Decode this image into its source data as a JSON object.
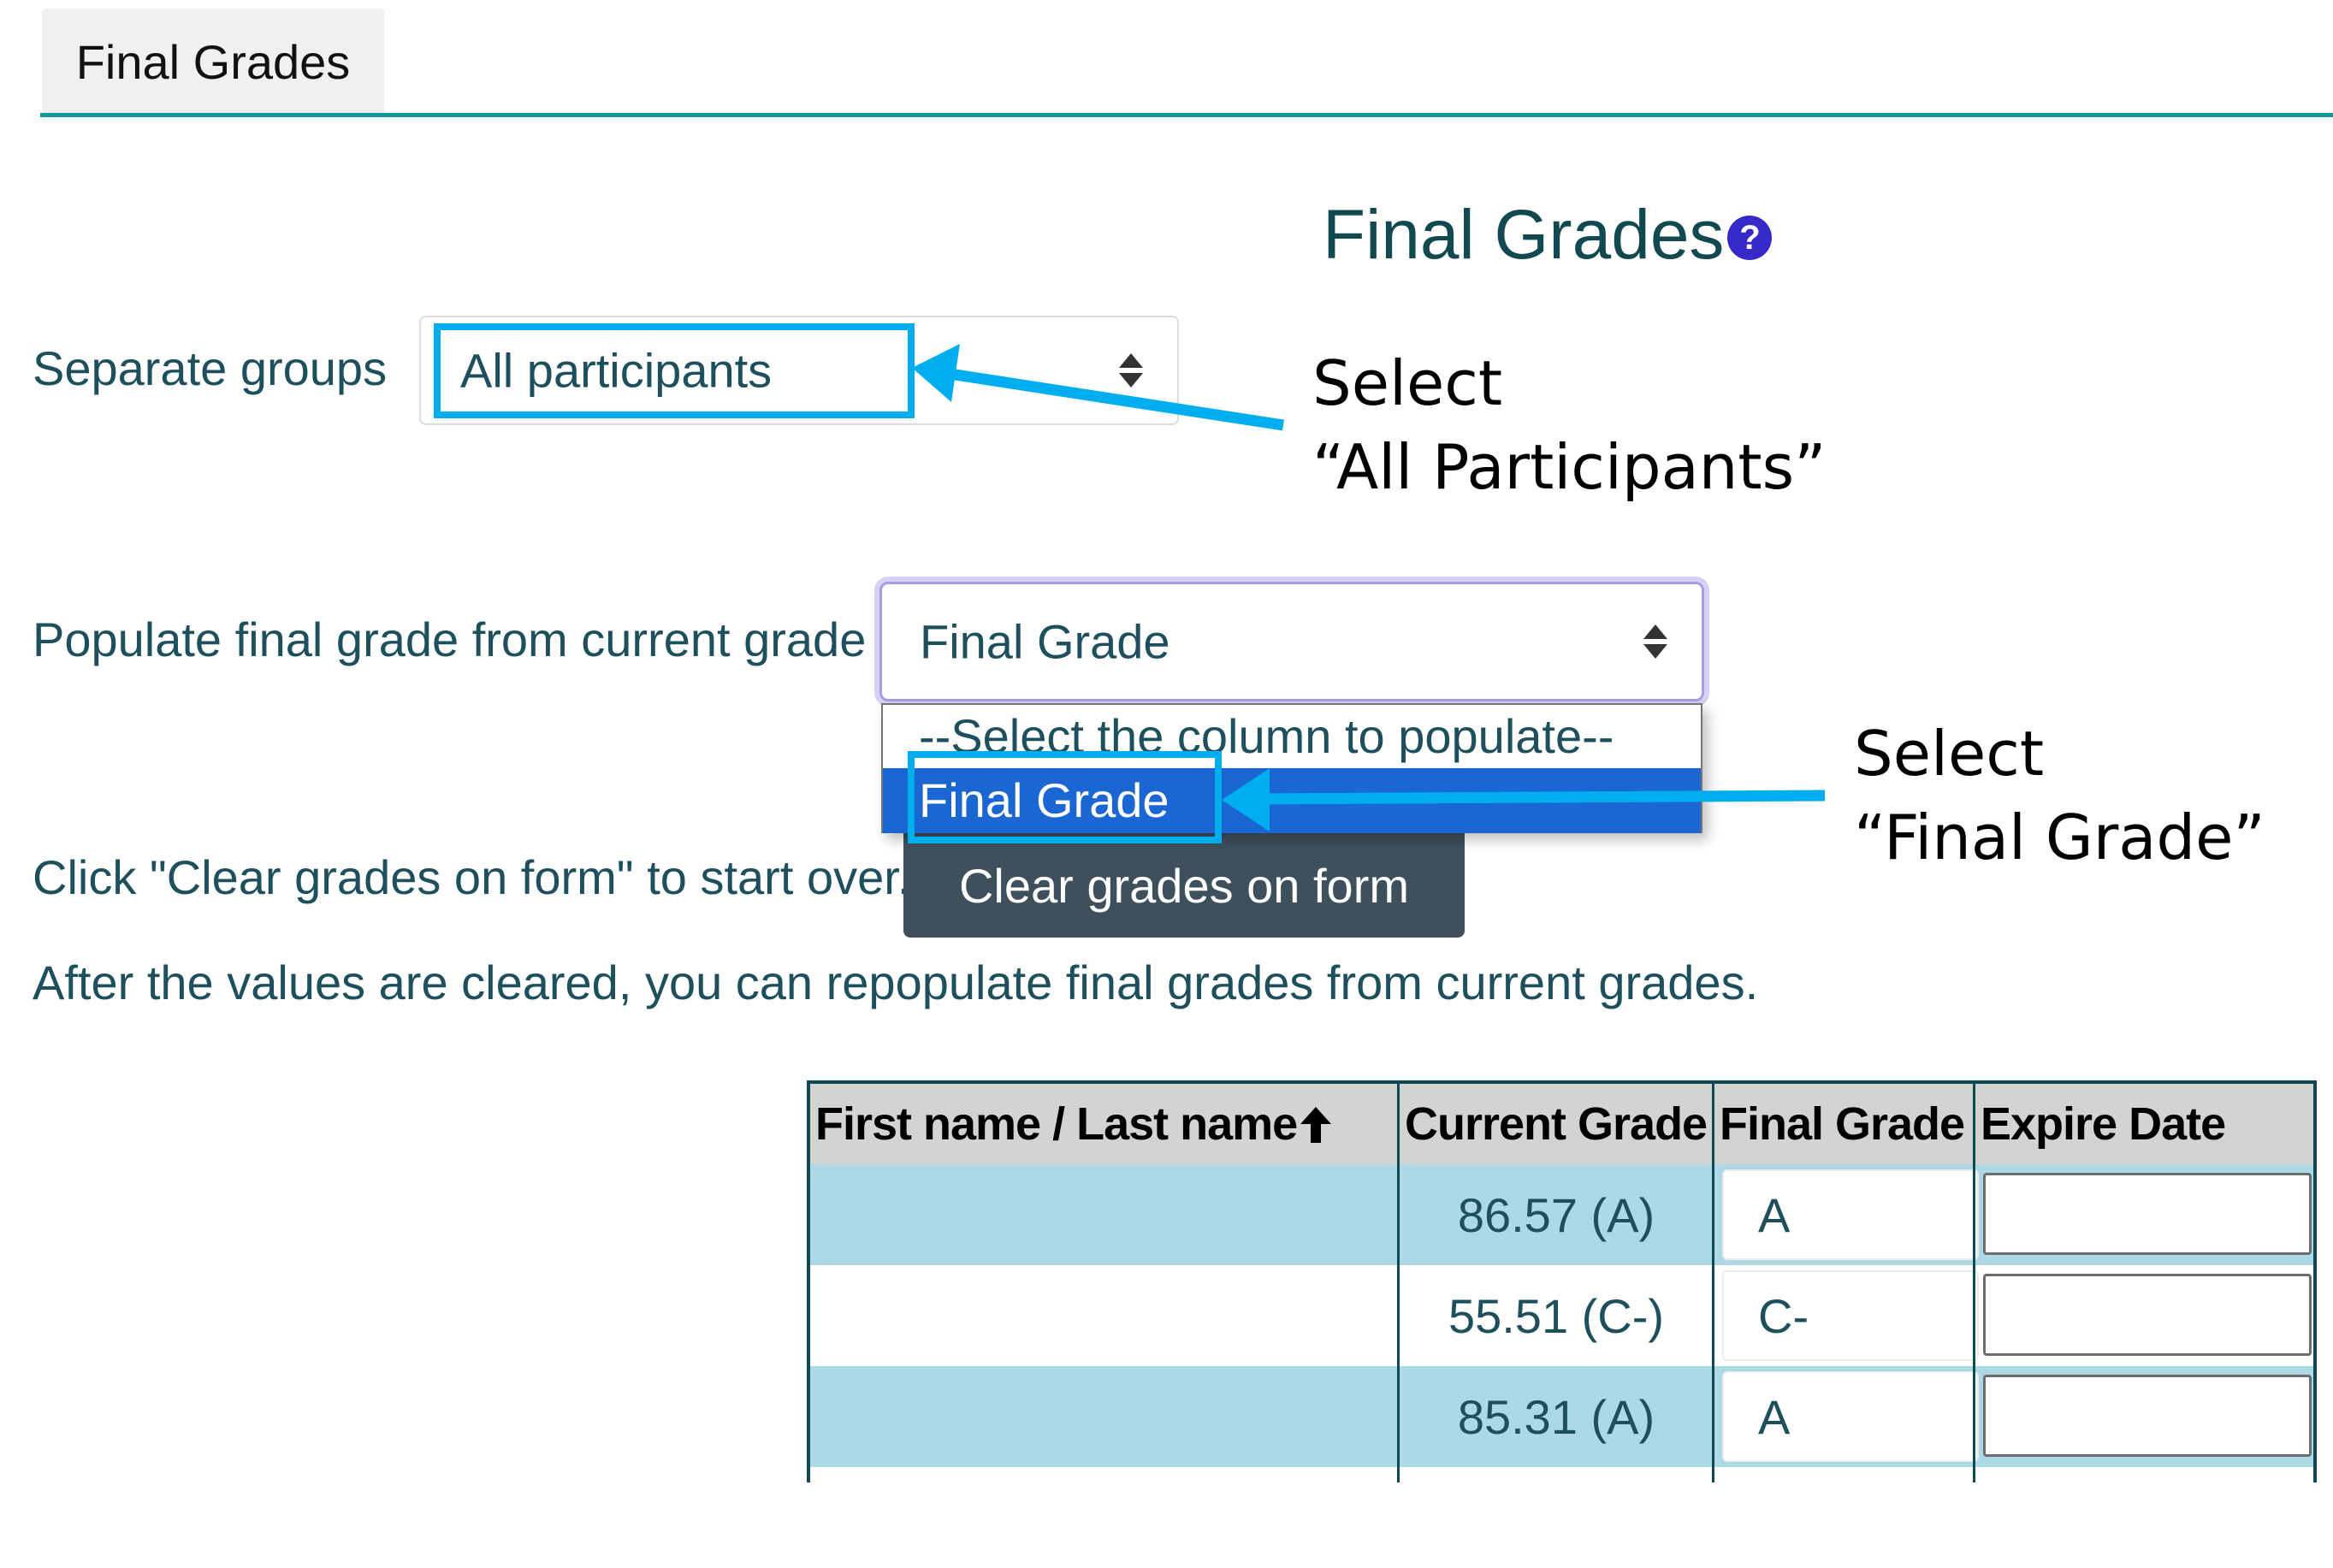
{
  "tabs": [
    {
      "label": "Final Grades",
      "active": true
    }
  ],
  "header": {
    "title": "Final Grades",
    "help_icon": "question-circle-icon"
  },
  "colors": {
    "accent": "#11969b",
    "highlight": "#00aeef",
    "selected_option": "#1a66d2",
    "button": "#3f505d",
    "row_alt": "#add8e6",
    "help": "#3728c9"
  },
  "group_filter": {
    "label": "Separate groups",
    "value": "All participants"
  },
  "populate": {
    "label": "Populate final grade from current grade",
    "value": "Final Grade",
    "options": [
      "--Select the column to populate--",
      "Final Grade"
    ],
    "highlighted_option": "Final Grade"
  },
  "clear": {
    "instruction": "Click \"Clear grades on form\" to start over.",
    "button_label": "Clear grades on form",
    "note": "After the values are cleared, you can repopulate final grades from current grades."
  },
  "annotations": [
    {
      "line1": "Select",
      "line2": "“All Participants”"
    },
    {
      "line1": "Select",
      "line2": "“Final Grade”"
    }
  ],
  "table": {
    "columns": [
      "First name / Last name",
      "Current Grade",
      "Final Grade",
      "Expire Date"
    ],
    "sort_icon": "arrow-up-icon",
    "rows": [
      {
        "name": "",
        "current_grade": "86.57 (A)",
        "final_grade": "A",
        "expire_date": ""
      },
      {
        "name": "",
        "current_grade": "55.51 (C-)",
        "final_grade": "C-",
        "expire_date": ""
      },
      {
        "name": "",
        "current_grade": "85.31 (A)",
        "final_grade": "A",
        "expire_date": ""
      }
    ]
  }
}
